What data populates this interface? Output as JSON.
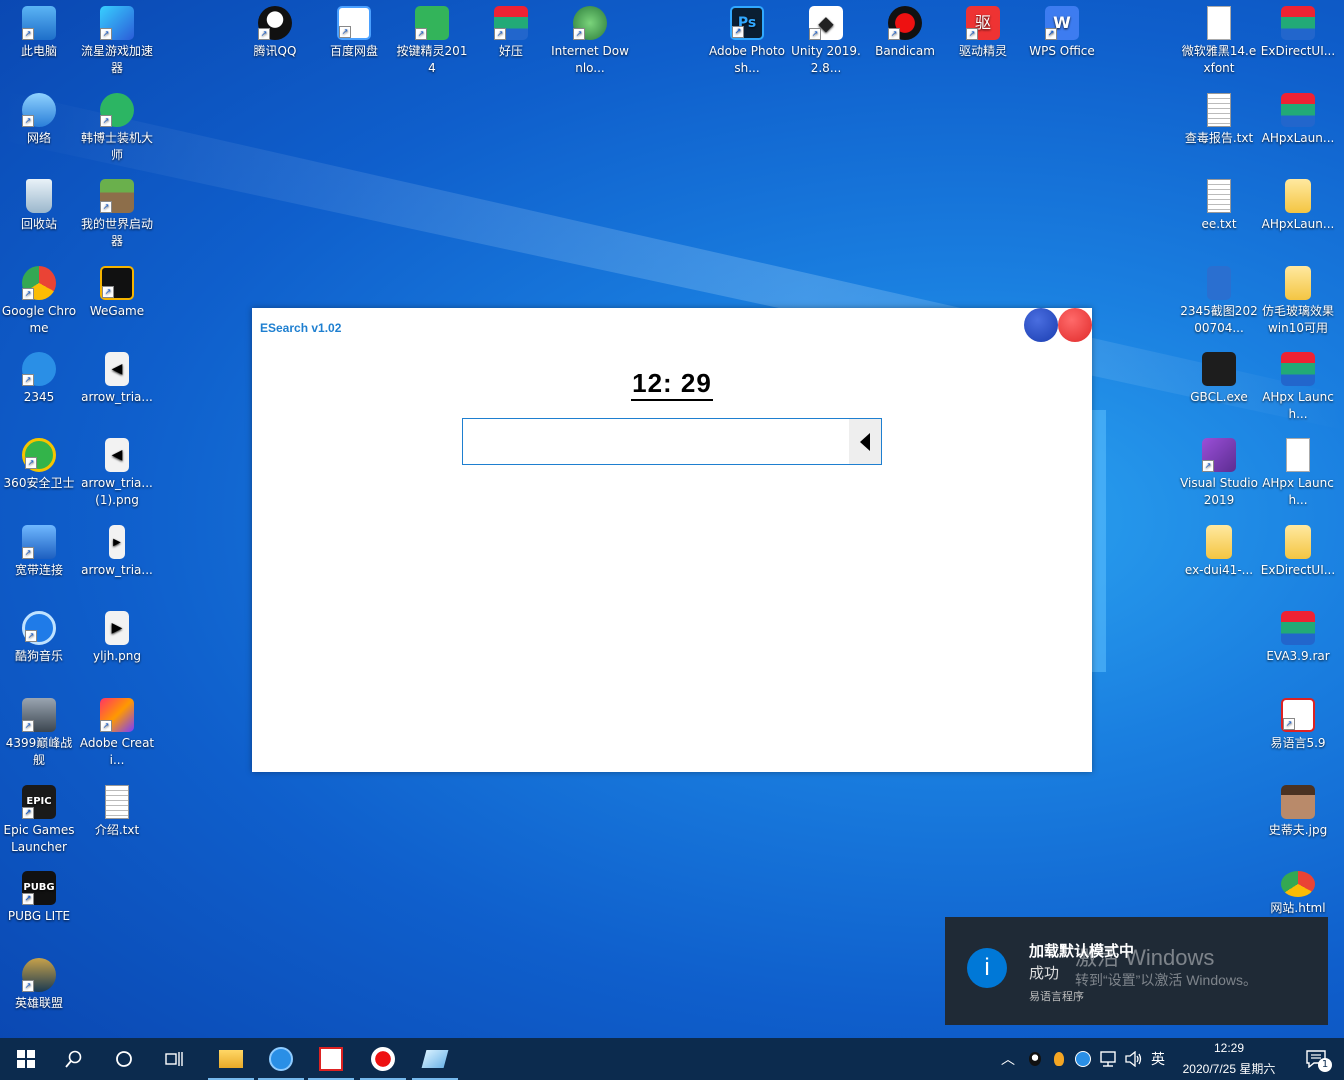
{
  "desktop": {
    "icons": [
      {
        "label": "此电脑"
      },
      {
        "label": "流星游戏加速器"
      },
      {
        "label": "网络"
      },
      {
        "label": "韩博士装机大师"
      },
      {
        "label": "回收站"
      },
      {
        "label": "我的世界启动器"
      },
      {
        "label": "Google Chrome"
      },
      {
        "label": "WeGame"
      },
      {
        "label": "2345"
      },
      {
        "label": "arrow_tria..."
      },
      {
        "label": "360安全卫士"
      },
      {
        "label": "arrow_tria... (1).png"
      },
      {
        "label": "宽带连接"
      },
      {
        "label": "arrow_tria..."
      },
      {
        "label": "酷狗音乐"
      },
      {
        "label": "yljh.png"
      },
      {
        "label": "4399巅峰战舰"
      },
      {
        "label": "Adobe Creati..."
      },
      {
        "label": "Epic Games Launcher"
      },
      {
        "label": "介绍.txt"
      },
      {
        "label": "PUBG LITE"
      },
      {
        "label": "英雄联盟"
      },
      {
        "label": "腾讯QQ"
      },
      {
        "label": "百度网盘"
      },
      {
        "label": "按键精灵2014"
      },
      {
        "label": "好压"
      },
      {
        "label": "Internet Downlo..."
      },
      {
        "label": "Adobe Photosh..."
      },
      {
        "label": "Unity 2019.2.8..."
      },
      {
        "label": "Bandicam"
      },
      {
        "label": "驱动精灵"
      },
      {
        "label": "WPS Office"
      },
      {
        "label": "微软雅黑14.exfont"
      },
      {
        "label": "ExDirectUI..."
      },
      {
        "label": "查毒报告.txt"
      },
      {
        "label": "AHpxLaun..."
      },
      {
        "label": "ee.txt"
      },
      {
        "label": "AHpxLaun..."
      },
      {
        "label": "2345截图20200704..."
      },
      {
        "label": "仿毛玻璃效果win10可用"
      },
      {
        "label": "GBCL.exe"
      },
      {
        "label": "AHpx Launch..."
      },
      {
        "label": "Visual Studio 2019"
      },
      {
        "label": "AHpx Launch..."
      },
      {
        "label": "ex-dui41-..."
      },
      {
        "label": "ExDirectUI..."
      },
      {
        "label": "EVA3.9.rar"
      },
      {
        "label": "易语言5.9"
      },
      {
        "label": "史蒂夫.jpg"
      },
      {
        "label": "网站.html"
      }
    ]
  },
  "esearch": {
    "title": "ESearch v1.02",
    "clock": "12: 29",
    "search_value": "",
    "search_placeholder": ""
  },
  "toast": {
    "title": "加载默认模式中",
    "body": "成功",
    "app": "易语言程序",
    "icon": "i"
  },
  "watermark": {
    "line1": "激活 Windows",
    "line2": "转到“设置”以激活 Windows。"
  },
  "taskbar": {
    "tray_ime": "英",
    "time": "12:29",
    "date": "2020/7/25 星期六",
    "notification_count": "1"
  },
  "colors": {
    "accent": "#1e7fd0",
    "taskbar": "#0c2b4e",
    "toast": "#1f2a36",
    "minimize": "#1a3db0",
    "close": "#e02a2a"
  }
}
